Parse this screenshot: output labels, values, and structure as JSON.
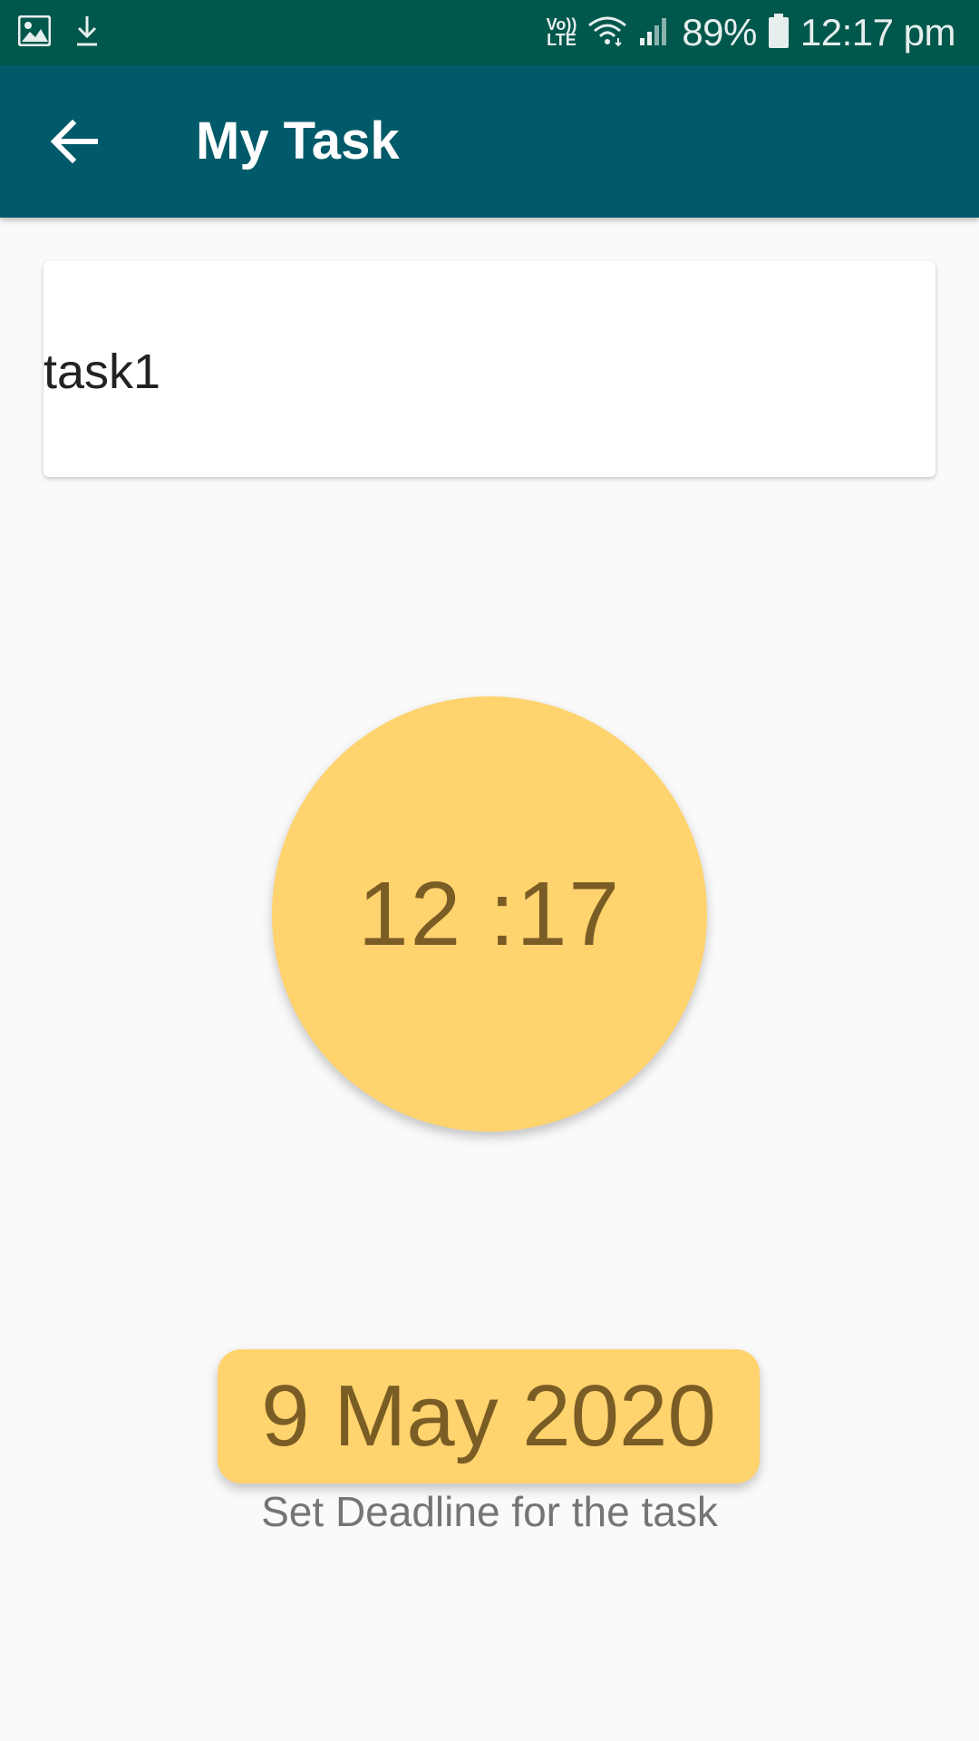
{
  "status_bar": {
    "network_line1": "Vo))",
    "network_line2": "LTE",
    "battery": "89%",
    "time": "12:17 pm",
    "icons": [
      "image-icon",
      "download-icon",
      "volte-icon",
      "wifi-icon",
      "signal-icon",
      "battery-icon"
    ]
  },
  "app_bar": {
    "title": "My Task",
    "back_icon": "arrow-back-icon"
  },
  "task": {
    "name": "task1"
  },
  "deadline": {
    "time": "12 :17",
    "date": "9 May 2020",
    "label": "Set Deadline for the task"
  },
  "colors": {
    "status_bar": "#00574b",
    "app_bar": "#005a69",
    "accent": "#ffd36e",
    "accent_text": "#7a5c25",
    "background": "#fafafa"
  }
}
